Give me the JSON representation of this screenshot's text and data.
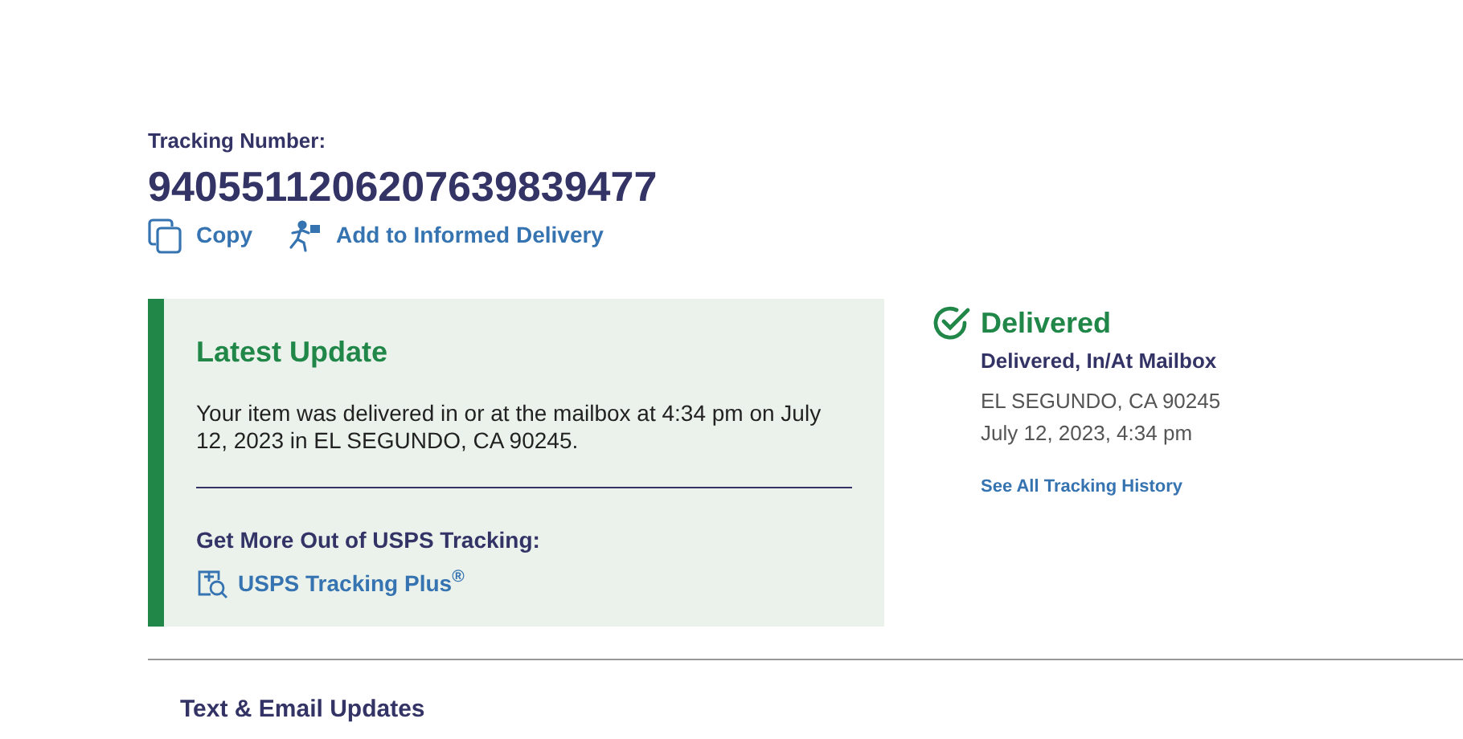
{
  "tracking": {
    "label": "Tracking Number:",
    "number": "9405511206207639839477"
  },
  "actions": [
    {
      "kind": "copy",
      "label": "Copy"
    },
    {
      "kind": "informed",
      "label": "Add to Informed Delivery"
    }
  ],
  "latest_update": {
    "title": "Latest Update",
    "message": "Your item was delivered in or at the mailbox at 4:34 pm on July 12, 2023 in EL SEGUNDO, CA 90245.",
    "more_title": "Get More Out of USPS Tracking:",
    "link": "USPS Tracking Plus$^{®}$"
  },
  "status": {
    "title": "Delivered",
    "detail": "Delivered, In/At Mailbox",
    "location": "EL SEGUNDO, CA 90245",
    "time": "July 12, 2023, 4:34 pm",
    "history_link": "See All Tracking History"
  },
  "section_title": "Text & Email Updates"
}
